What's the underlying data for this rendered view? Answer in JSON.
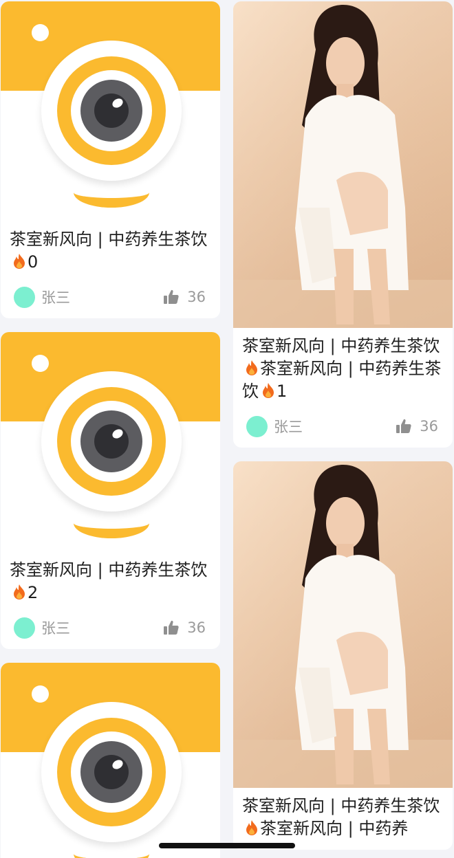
{
  "feed": {
    "left_column": [
      {
        "title": "茶室新风向 | 中药养生茶饮",
        "index": "0",
        "author": "张三",
        "likes": "36",
        "cover_icon": "camera-app-icon"
      },
      {
        "title": "茶室新风向 | 中药养生茶饮",
        "index": "2",
        "author": "张三",
        "likes": "36",
        "cover_icon": "camera-app-icon"
      },
      {
        "cover_icon": "camera-app-icon"
      }
    ],
    "right_column": [
      {
        "title": "茶室新风向 | 中药养生茶饮",
        "title_extra": "茶室新风向 | 中药养生茶饮",
        "index": "1",
        "author": "张三",
        "likes": "36",
        "cover": "photo-woman-white-shirt"
      },
      {
        "title": "茶室新风向 | 中药养生茶饮",
        "title_extra": "茶室新风向 | 中药养",
        "cover": "photo-woman-white-shirt"
      }
    ]
  },
  "colors": {
    "accent_yellow": "#fbba2f",
    "avatar_mint": "#7cefd0",
    "background": "#f3f4f8"
  },
  "icons": {
    "flame": "fire-icon",
    "like": "thumbs-up-icon"
  }
}
